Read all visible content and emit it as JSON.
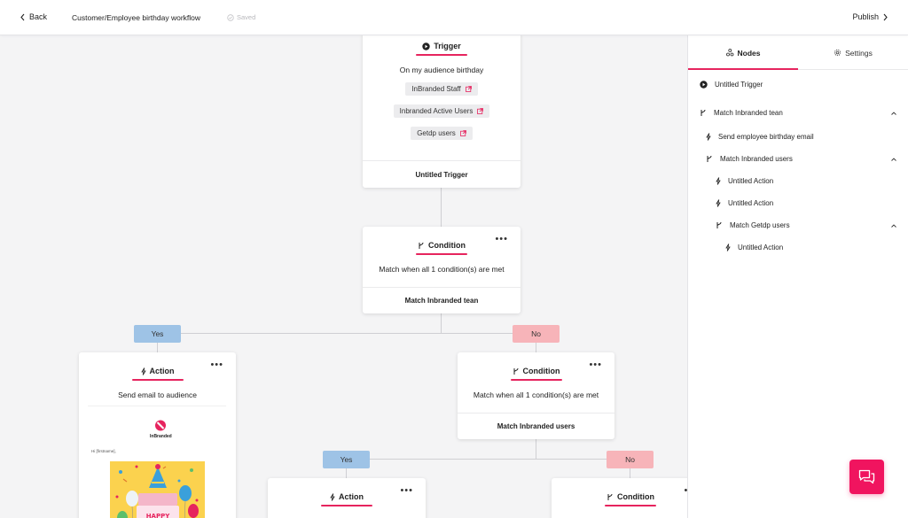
{
  "header": {
    "back_label": "Back",
    "workflow_title": "Customer/Employee birthday workflow",
    "saved_label": "Saved",
    "publish_label": "Publish"
  },
  "colors": {
    "accent": "#e6245e",
    "fab": "#f0145f",
    "yes_badge": "#9ec3e6",
    "no_badge": "#f7b4b9"
  },
  "canvas": {
    "trigger_node": {
      "header": "Trigger",
      "description": "On my audience birthday",
      "tags": [
        "InBranded Staff",
        "Inbranded Active Users",
        "Getdp users"
      ],
      "footer": "Untitled Trigger"
    },
    "condition_node_1": {
      "header": "Condition",
      "description": "Match when all 1 condition(s) are met",
      "footer": "Match Inbranded tean"
    },
    "yes_badge_1": "Yes",
    "no_badge_1": "No",
    "action_node_1": {
      "header": "Action",
      "description": "Send email to audience",
      "email_brand": "InBranded",
      "email_greeting": "Hi [firstname],"
    },
    "condition_node_2": {
      "header": "Condition",
      "description": "Match when all 1 condition(s) are met",
      "footer": "Match Inbranded users"
    },
    "yes_badge_2": "Yes",
    "no_badge_2": "No",
    "action_node_2": {
      "header": "Action"
    },
    "condition_node_3": {
      "header": "Condition"
    }
  },
  "panel": {
    "tabs": [
      {
        "label": "Nodes",
        "icon": "nodes-icon",
        "active": true
      },
      {
        "label": "Settings",
        "icon": "gear-icon",
        "active": false
      }
    ],
    "tree": [
      {
        "label": "Untitled Trigger",
        "icon": "play-icon",
        "level": 0
      },
      {
        "label": "Match Inbranded tean",
        "icon": "branch-icon",
        "level": 0,
        "expanded": true
      },
      {
        "label": "Send employee birthday email",
        "icon": "bolt-icon",
        "level": 1
      },
      {
        "label": "Match Inbranded users",
        "icon": "branch-icon",
        "level": 1,
        "expanded": true
      },
      {
        "label": "Untitled Action",
        "icon": "bolt-icon",
        "level": 2
      },
      {
        "label": "Untitled Action",
        "icon": "bolt-icon",
        "level": 2
      },
      {
        "label": "Match Getdp users",
        "icon": "branch-icon",
        "level": 2,
        "expanded": true
      },
      {
        "label": "Untitled Action",
        "icon": "bolt-icon",
        "level": 3
      }
    ]
  }
}
